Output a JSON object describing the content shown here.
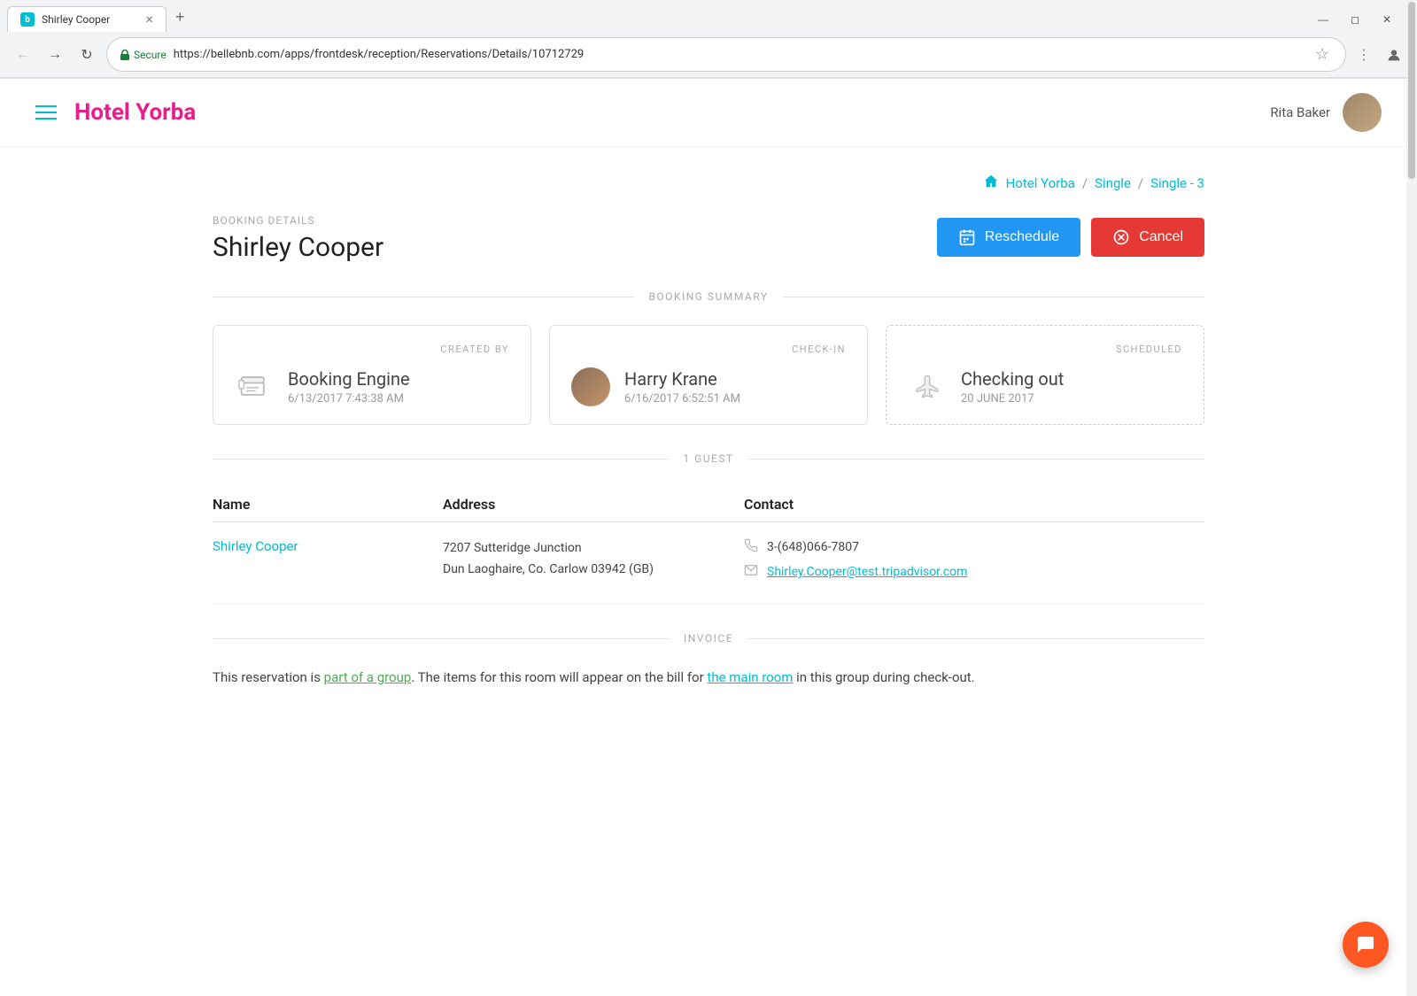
{
  "browser": {
    "tab_favicon": "b",
    "tab_title": "Shirley Cooper",
    "tab_close": "×",
    "url": "https://bellebnb.com/apps/frontdesk/reception/Reservations/Details/10712729",
    "secure_label": "Secure",
    "minimize": "—",
    "restore": "◻",
    "close": "✕"
  },
  "header": {
    "logo": "Hotel Yorba",
    "logo_hotel": "Hotel ",
    "logo_yorba": "Yorba",
    "user_name": "Rita Baker"
  },
  "breadcrumb": {
    "home_icon": "⌂",
    "hotel": "Hotel Yorba",
    "separator1": "/",
    "single": "Single",
    "separator2": "/",
    "room": "Single - 3"
  },
  "booking": {
    "label": "BOOKING DETAILS",
    "guest_name": "Shirley Cooper",
    "reschedule_label": "Reschedule",
    "cancel_label": "Cancel"
  },
  "booking_summary": {
    "section_label": "BOOKING SUMMARY",
    "cards": [
      {
        "label": "CREATED BY",
        "main": "Booking Engine",
        "sub": "6/13/2017 7:43:38 AM",
        "type": "engine"
      },
      {
        "label": "CHECK-IN",
        "main": "Harry Krane",
        "sub": "6/16/2017 6:52:51 AM",
        "type": "person"
      },
      {
        "label": "SCHEDULED",
        "main": "Checking out",
        "sub": "20 JUNE 2017",
        "type": "plane"
      }
    ]
  },
  "guests": {
    "section_label": "1 GUEST",
    "columns": [
      "Name",
      "Address",
      "Contact"
    ],
    "rows": [
      {
        "name": "Shirley Cooper",
        "address_line1": "7207 Sutteridge Junction",
        "address_line2": "Dun Laoghaire, Co. Carlow 03942 (GB)",
        "phone": "3-(648)066-7807",
        "email": "Shirley.Cooper@test.tripadvisor.com"
      }
    ]
  },
  "invoice": {
    "section_label": "INVOICE",
    "text_before": "This reservation is ",
    "link1_text": "part of a group",
    "text_middle": ". The items for this room will appear on the bill for ",
    "link2_text": "the main room",
    "text_after": " in this group during check-out."
  }
}
